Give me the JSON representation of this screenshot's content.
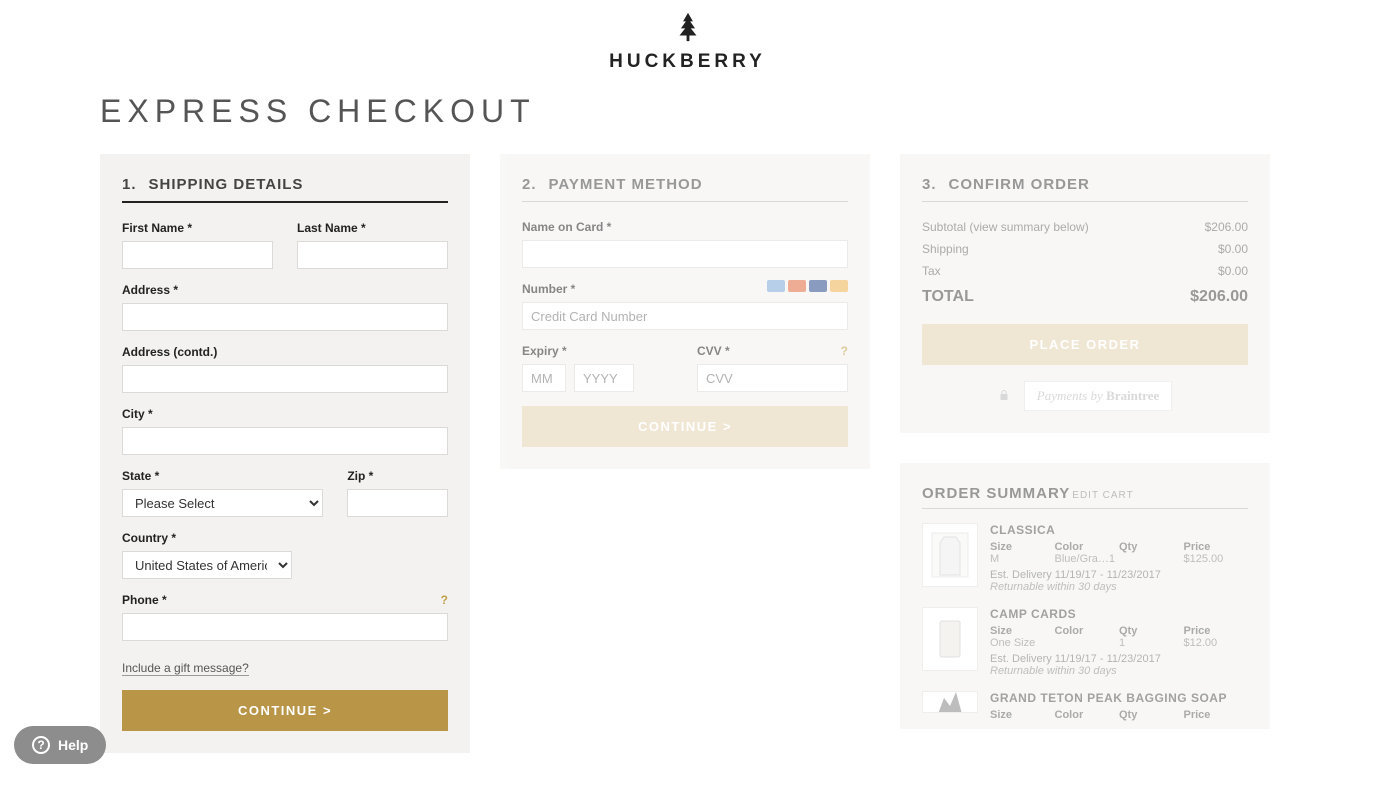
{
  "brand": "HUCKBERRY",
  "page_title": "EXPRESS CHECKOUT",
  "steps": {
    "shipping": {
      "num": "1.",
      "title": "SHIPPING DETAILS"
    },
    "payment": {
      "num": "2.",
      "title": "PAYMENT METHOD"
    },
    "confirm": {
      "num": "3.",
      "title": "CONFIRM ORDER"
    }
  },
  "shipping": {
    "first_name_label": "First Name *",
    "last_name_label": "Last Name *",
    "address_label": "Address *",
    "address2_label": "Address (contd.)",
    "city_label": "City *",
    "state_label": "State *",
    "state_placeholder": "Please Select",
    "zip_label": "Zip *",
    "country_label": "Country *",
    "country_value": "United States of America",
    "phone_label": "Phone *",
    "gift_link": "Include a gift message?",
    "continue_label": "CONTINUE >"
  },
  "payment": {
    "name_label": "Name on Card *",
    "number_label": "Number *",
    "number_placeholder": "Credit Card Number",
    "expiry_label": "Expiry *",
    "expiry_mm_placeholder": "MM",
    "expiry_yyyy_placeholder": "YYYY",
    "cvv_label": "CVV *",
    "cvv_placeholder": "CVV",
    "continue_label": "CONTINUE >"
  },
  "confirm": {
    "subtotal_label": "Subtotal (view summary below)",
    "subtotal_value": "$206.00",
    "shipping_label": "Shipping",
    "shipping_value": "$0.00",
    "tax_label": "Tax",
    "tax_value": "$0.00",
    "total_label": "TOTAL",
    "total_value": "$206.00",
    "place_order_label": "PLACE ORDER",
    "processor_prefix": "Payments by ",
    "processor_name": "Braintree"
  },
  "order_summary": {
    "title": "ORDER SUMMARY",
    "edit_label": "EDIT CART",
    "col_labels": {
      "size": "Size",
      "color": "Color",
      "qty": "Qty",
      "price": "Price"
    },
    "items": [
      {
        "name": "CLASSICA",
        "size": "M",
        "color": "Blue/Gra…1",
        "qty": "",
        "price": "$125.00",
        "delivery": "Est. Delivery 11/19/17 - 11/23/2017",
        "returnable": "Returnable within 30 days"
      },
      {
        "name": "CAMP CARDS",
        "size": "One Size",
        "color": "",
        "qty": "1",
        "price": "$12.00",
        "delivery": "Est. Delivery 11/19/17 - 11/23/2017",
        "returnable": "Returnable within 30 days"
      },
      {
        "name": "GRAND TETON PEAK BAGGING SOAP",
        "size": "",
        "color": "",
        "qty": "",
        "price": "",
        "delivery": "",
        "returnable": ""
      }
    ]
  },
  "help_label": "Help"
}
